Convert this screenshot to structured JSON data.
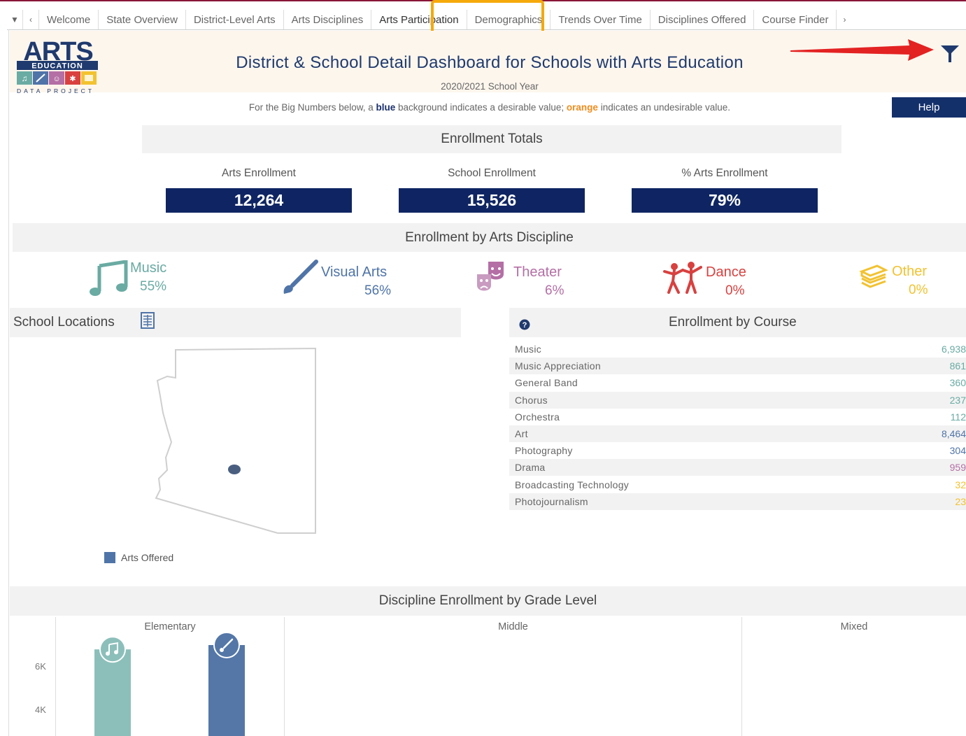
{
  "tabs": {
    "items": [
      "Welcome",
      "State Overview",
      "District-Level Arts",
      "Arts Disciplines",
      "Arts Participation",
      "Demographics",
      "Trends Over Time",
      "Disciplines Offered",
      "Course Finder"
    ],
    "active": "Arts Participation"
  },
  "logo": {
    "line1": "ARTS",
    "line2": "EDUCATION",
    "line3": "DATA PROJECT"
  },
  "header": {
    "title": "District & School Detail Dashboard for Schools with Arts Education",
    "subtitle": "2020/2021 School Year",
    "note_pre": "For the Big Numbers below, a ",
    "note_blue": "blue",
    "note_mid": " background indicates a desirable value; ",
    "note_orange": "orange",
    "note_post": " indicates an undesirable value.",
    "help_label": "Help"
  },
  "enrollment_totals": {
    "heading": "Enrollment Totals",
    "metrics": [
      {
        "label": "Arts Enrollment",
        "value": "12,264"
      },
      {
        "label": "School Enrollment",
        "value": "15,526"
      },
      {
        "label": "% Arts Enrollment",
        "value": "79%"
      }
    ]
  },
  "disciplines": {
    "heading": "Enrollment by Arts Discipline",
    "items": [
      {
        "name": "Music",
        "pct": "55%",
        "color": "#6aaba3",
        "icon": "music-note-icon"
      },
      {
        "name": "Visual Arts",
        "pct": "56%",
        "color": "#4f74a8",
        "icon": "paintbrush-icon"
      },
      {
        "name": "Theater",
        "pct": "6%",
        "color": "#b46fa5",
        "icon": "theater-masks-icon"
      },
      {
        "name": "Dance",
        "pct": "0%",
        "color": "#d8413f",
        "icon": "dancers-icon"
      },
      {
        "name": "Other",
        "pct": "0%",
        "color": "#f2c230",
        "icon": "books-icon"
      }
    ]
  },
  "locations": {
    "heading": "School Locations",
    "legend": "Arts Offered",
    "legend_color": "#4f74a8"
  },
  "courses": {
    "heading": "Enrollment by Course",
    "rows": [
      {
        "name": "Music",
        "value": "6,938",
        "color": "#6aaba3"
      },
      {
        "name": "Music Appreciation",
        "value": "861",
        "color": "#6aaba3"
      },
      {
        "name": "General Band",
        "value": "360",
        "color": "#6aaba3"
      },
      {
        "name": "Chorus",
        "value": "237",
        "color": "#6aaba3"
      },
      {
        "name": "Orchestra",
        "value": "112",
        "color": "#6aaba3"
      },
      {
        "name": "Art",
        "value": "8,464",
        "color": "#4f74a8"
      },
      {
        "name": "Photography",
        "value": "304",
        "color": "#4f74a8"
      },
      {
        "name": "Drama",
        "value": "959",
        "color": "#b46fa5"
      },
      {
        "name": "Broadcasting Technology",
        "value": "32",
        "color": "#f2c230"
      },
      {
        "name": "Photojournalism",
        "value": "23",
        "color": "#f2c230"
      }
    ]
  },
  "grade_chart": {
    "heading": "Discipline Enrollment by Grade Level",
    "panels": [
      "Elementary",
      "Middle",
      "Mixed"
    ],
    "ticks": [
      "6K",
      "4K"
    ]
  },
  "chart_data": {
    "type": "bar",
    "title": "Discipline Enrollment by Grade Level",
    "panels": [
      "Elementary",
      "Middle",
      "Mixed"
    ],
    "categories": [
      "Music",
      "Visual Arts"
    ],
    "series": [
      {
        "panel": "Elementary",
        "values": [
          6800,
          7000
        ]
      }
    ],
    "yticks": [
      "6K",
      "4K"
    ],
    "colors": [
      "#8cbfba",
      "#5477a8"
    ]
  }
}
